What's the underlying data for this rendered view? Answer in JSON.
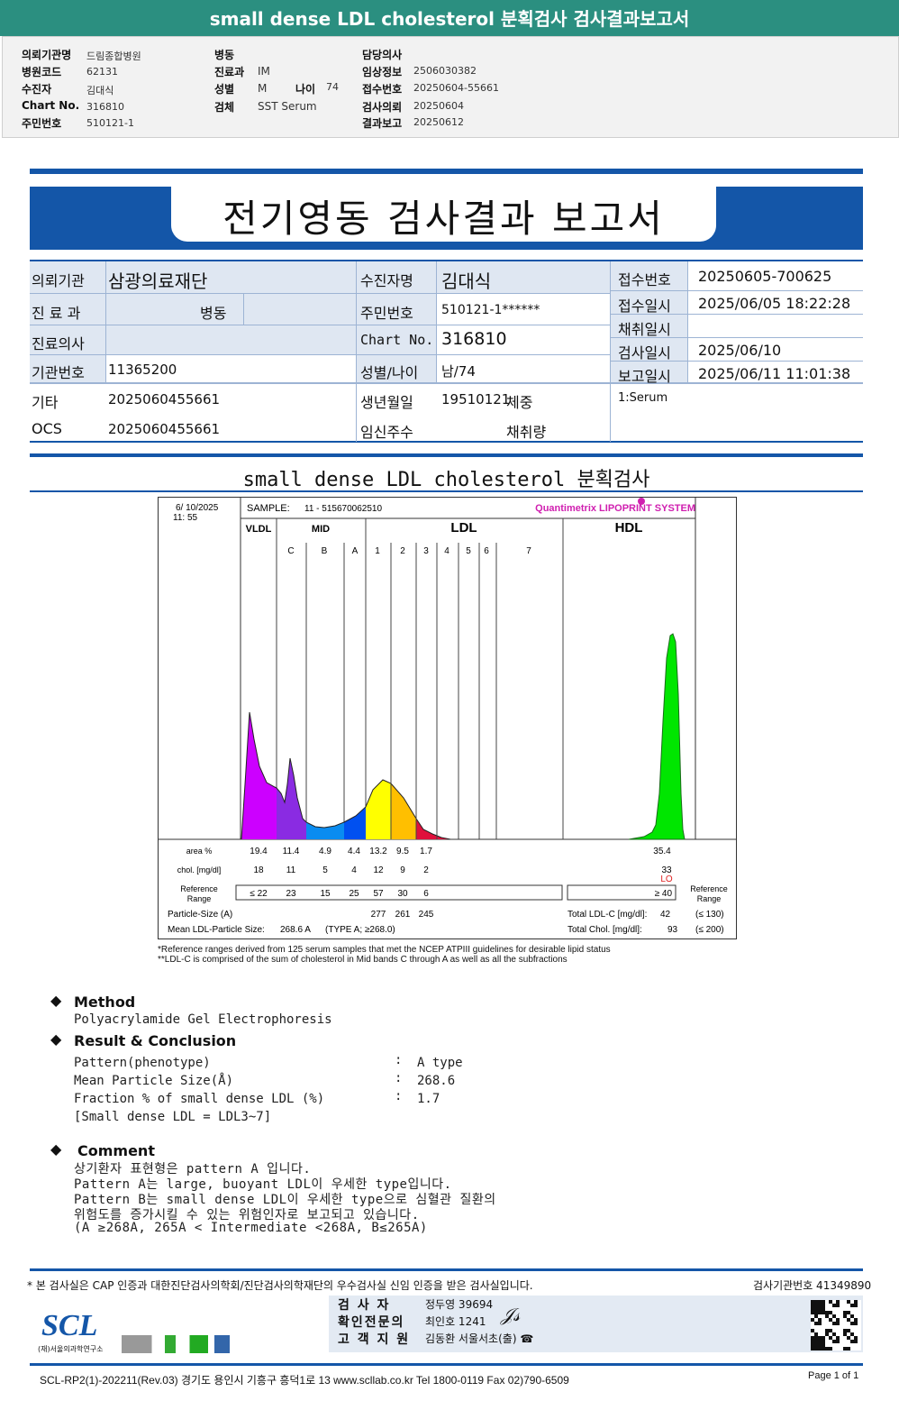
{
  "header": {
    "title": "small dense LDL cholesterol 분획검사 검사결과보고서"
  },
  "info": {
    "c1": [
      [
        "의뢰기관명",
        "드림종합병원"
      ],
      [
        "병원코드",
        "62131"
      ],
      [
        "수진자",
        "김대식"
      ],
      [
        "Chart No.",
        "316810"
      ],
      [
        "주민번호",
        "510121-1"
      ]
    ],
    "c2": [
      [
        "병동",
        ""
      ],
      [
        "진료과",
        "IM"
      ],
      [
        "성별",
        "M"
      ],
      [
        "검체",
        "SST Serum"
      ]
    ],
    "age_label": "나이",
    "age": "74",
    "c3": [
      [
        "담당의사",
        ""
      ],
      [
        "임상정보",
        "2506030382"
      ],
      [
        "접수번호",
        "20250604-55661"
      ],
      [
        "검사의뢰",
        "20250604"
      ],
      [
        "결과보고",
        "20250612"
      ]
    ]
  },
  "report": {
    "title": "전기영동 검사결과 보고서"
  },
  "table": {
    "inst_label": "의뢰기관",
    "inst": "삼광의료재단",
    "dept_label": "진 료 과",
    "ward_label": "병동",
    "doctor_label": "진료의사",
    "code_label": "기관번호",
    "code": "11365200",
    "etc_label": "기타",
    "etc": "2025060455661",
    "ocs_label": "OCS",
    "ocs": "2025060455661",
    "name_label": "수진자명",
    "name": "김대식",
    "rrn_label": "주민번호",
    "rrn": "510121-1******",
    "chart_label": "Chart No.",
    "chart": "316810",
    "sexage_label": "성별/나이",
    "sexage": "남/74",
    "birth_label": "생년월일",
    "birth": "19510121",
    "weight_label": "체중",
    "preg_label": "임신주수",
    "vol_label": "채취량",
    "recv_no_label": "접수번호",
    "recv_no": "20250605-700625",
    "recv_dt_label": "접수일시",
    "recv_dt": "2025/06/05 18:22:28",
    "coll_label": "채취일시",
    "test_label": "검사일시",
    "test_dt": "2025/06/10",
    "rep_label": "보고일시",
    "rep_dt": "2025/06/11 11:01:38",
    "specimen": "1:Serum"
  },
  "section_title": "small dense LDL cholesterol 분획검사",
  "chart_data": {
    "type": "area",
    "datetime": [
      "6/ 10/2025",
      "11: 55"
    ],
    "sample_label": "SAMPLE:",
    "sample": "11 - 515670062510",
    "brand": "Quantimetrix LIPOPRINT SYSTEM",
    "groups": [
      "VLDL",
      "MID",
      "LDL",
      "HDL"
    ],
    "bands": [
      "C",
      "B",
      "A",
      "1",
      "2",
      "3",
      "4",
      "5",
      "6",
      "7"
    ],
    "colors": {
      "VLDL": "#cc00ff",
      "MID C": "#8a2be2",
      "MID B": "#0a8cf0",
      "MID A": "#0050f0",
      "LDL1": "#ffff00",
      "LDL2": "#ffbf00",
      "LDL3": "#e0103c",
      "HDL": "#00e600"
    },
    "row_labels": {
      "area": "area %",
      "chol": "chol. [mg/dl]",
      "ref": [
        "Reference",
        "Range"
      ],
      "psize": "Particle-Size (A)",
      "mean": "Mean LDL-Particle Size:"
    },
    "area": [
      "19.4",
      "11.4",
      "4.9",
      "4.4",
      "13.2",
      "9.5",
      "1.7"
    ],
    "area_hdl": "35.4",
    "chol": [
      "18",
      "11",
      "5",
      "4",
      "12",
      "9",
      "2"
    ],
    "chol_hdl": "33",
    "chol_hdl_flag": "LO",
    "ref": [
      "≤ 22",
      "23",
      "15",
      "25",
      "57",
      "30",
      "6"
    ],
    "ref_hdl": "≥  40",
    "psize": [
      "277",
      "261",
      "245"
    ],
    "mean_value": "268.6  A",
    "mean_type": "(TYPE A; ≥268.0)",
    "total_ldl_label": "Total LDL-C  [mg/dl]:",
    "total_ldl": "42",
    "total_ldl_ref": "(≤ 130)",
    "total_chol_label": "Total Chol.  [mg/dl]:",
    "total_chol": "93",
    "total_chol_ref": "(≤ 200)",
    "notes": [
      "*Reference ranges derived from 125 serum samples that met the NCEP ATPIII guidelines for desirable lipid status",
      "**LDL-C is comprised of the sum of cholesterol in Mid bands C through A as well as all the subfractions"
    ]
  },
  "method": {
    "title": "Method",
    "text": "Polyacrylamide Gel Electrophoresis"
  },
  "result": {
    "title": "Result & Conclusion",
    "rows": [
      [
        "Pattern(phenotype)",
        ":",
        "A type"
      ],
      [
        "Mean Particle Size(Å)",
        ":",
        "268.6"
      ],
      [
        "Fraction % of small dense LDL (%)",
        ":",
        "1.7"
      ]
    ],
    "note": "[Small dense LDL = LDL3~7]"
  },
  "comment": {
    "title": "Comment",
    "lines": [
      "상기환자 표현형은 pattern A 입니다.",
      "Pattern A는 large, buoyant LDL이 우세한 type입니다.",
      "Pattern B는 small dense LDL이 우세한 type으로 심혈관 질환의",
      "위험도를 증가시킬 수 있는 위험인자로 보고되고 있습니다.",
      "(A ≥268A, 265A < Intermediate <268A, B≤265A)"
    ]
  },
  "footer": {
    "cert": "* 본 검사실은 CAP 인증과 대한진단검사의학회/진단검사의학재단의 우수검사실 신임 인증을 받은 검사실입니다.",
    "lab_no": "검사기관번호 41349890",
    "sign": [
      [
        "검  사  자",
        "정두영 39694"
      ],
      [
        "확인전문의",
        "최인호 1241"
      ],
      [
        "고 객 지 원",
        "김동환 서울서초(출) ☎"
      ]
    ],
    "logo": "SCL",
    "logo_sub": "(재)서울의과학연구소",
    "address": "SCL-RP2(1)-202211(Rev.03)  경기도 용인시 기흥구 흥덕1로 13  www.scllab.co.kr   Tel 1800-0119    Fax 02)790-6509",
    "page": "Page 1 of 1"
  }
}
